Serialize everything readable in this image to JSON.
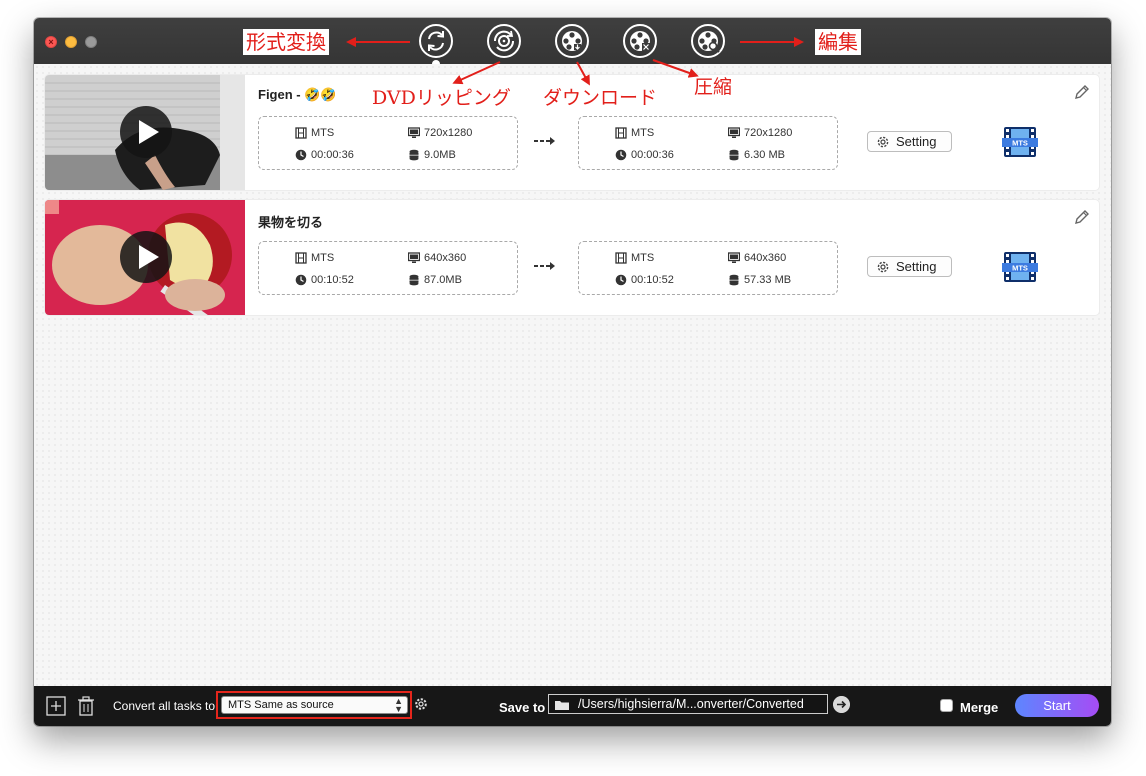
{
  "annotations": {
    "convert": "形式変換",
    "edit": "編集",
    "dvd": "DVDリッピング",
    "download": "ダウンロード",
    "compress": "圧縮"
  },
  "toolbar": {
    "tools": [
      "convert-icon",
      "dvd-rip-icon",
      "download-icon",
      "compress-icon",
      "edit-video-icon"
    ]
  },
  "tasks": [
    {
      "title": "Figen - 🤣🤣",
      "source": {
        "format": "MTS",
        "resolution": "720x1280",
        "duration": "00:00:36",
        "size": "9.0MB"
      },
      "output": {
        "format": "MTS",
        "resolution": "720x1280",
        "duration": "00:00:36",
        "size": "6.30 MB"
      },
      "setting_label": "Setting",
      "format_icon_label": "MTS"
    },
    {
      "title": "果物を切る",
      "source": {
        "format": "MTS",
        "resolution": "640x360",
        "duration": "00:10:52",
        "size": "87.0MB"
      },
      "output": {
        "format": "MTS",
        "resolution": "640x360",
        "duration": "00:10:52",
        "size": "57.33 MB"
      },
      "setting_label": "Setting",
      "format_icon_label": "MTS"
    }
  ],
  "bottom": {
    "convert_label": "Convert all tasks to",
    "format_value": "MTS Same as source",
    "save_label": "Save to",
    "save_path": "/Users/highsierra/M...onverter/Converted",
    "merge_label": "Merge",
    "merge_checked": false,
    "start_label": "Start"
  },
  "colors": {
    "titlebar": "#3a3a3a",
    "bottombar": "#171717",
    "annotation": "#e21f1a",
    "start_gradient": [
      "#5d86ff",
      "#a64cf4"
    ]
  }
}
